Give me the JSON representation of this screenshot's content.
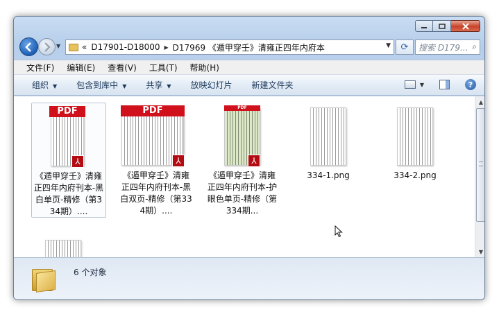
{
  "window": {
    "caption_buttons": [
      "minimize-icon",
      "maximize-icon",
      "close-icon"
    ]
  },
  "address": {
    "history": "«",
    "segments": [
      "D17901-D18000",
      "D17969 《遁甲穿壬》清雍正四年内府本"
    ],
    "search_placeholder": "搜索 D179..."
  },
  "menu": [
    "文件(F)",
    "编辑(E)",
    "查看(V)",
    "工具(T)",
    "帮助(H)"
  ],
  "toolbar": {
    "organize": "组织",
    "include_in_library": "包含到库中",
    "share": "共享",
    "slideshow": "放映幻灯片",
    "new_folder": "新建文件夹"
  },
  "files": [
    {
      "name": "《遁甲穿壬》清雍正四年内府刊本-黑白单页-精修（第334期）....",
      "type": "pdf",
      "badge": "PDF",
      "selected": true
    },
    {
      "name": "《遁甲穿壬》清雍正四年内府刊本-黑白双页-精修（第334期）....",
      "type": "pdf",
      "badge": "PDF",
      "selected": false
    },
    {
      "name": "《遁甲穿壬》清雍正四年内府刊本-护眼色单页-精修（第334期...",
      "type": "pdf",
      "badge": "PDF",
      "selected": false
    },
    {
      "name": "334-1.png",
      "type": "png",
      "selected": false
    },
    {
      "name": "334-2.png",
      "type": "png",
      "selected": false
    },
    {
      "name": "",
      "type": "png",
      "selected": false
    }
  ],
  "details": {
    "count": "6 个对象"
  },
  "colors": {
    "pdf_red": "#d0101a",
    "accent": "#1e5fb5"
  }
}
